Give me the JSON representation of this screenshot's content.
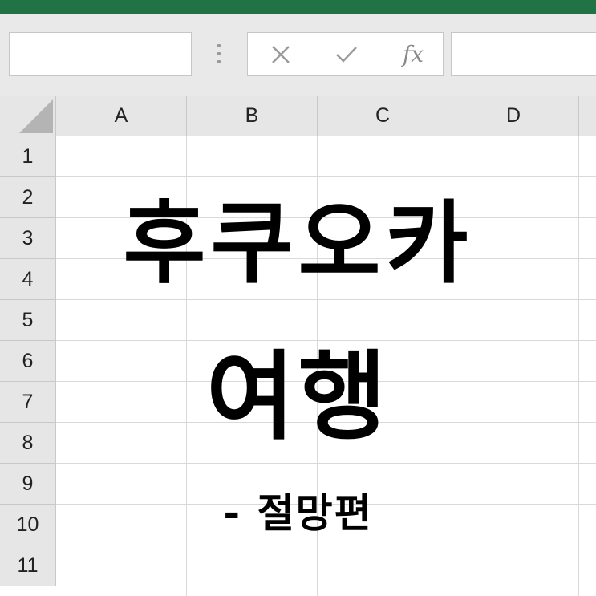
{
  "formula_bar": {
    "cancel_glyph": "✕",
    "enter_glyph": "✓",
    "fx_label": "fx"
  },
  "columns": [
    "A",
    "B",
    "C",
    "D"
  ],
  "rows": [
    "1",
    "2",
    "3",
    "4",
    "5",
    "6",
    "7",
    "8",
    "9",
    "10",
    "11"
  ],
  "overlay": {
    "line1": "후쿠오카",
    "line2": "여행",
    "line3": "- 절망편"
  },
  "colors": {
    "ribbon_green": "#217346",
    "text": "#000000"
  }
}
